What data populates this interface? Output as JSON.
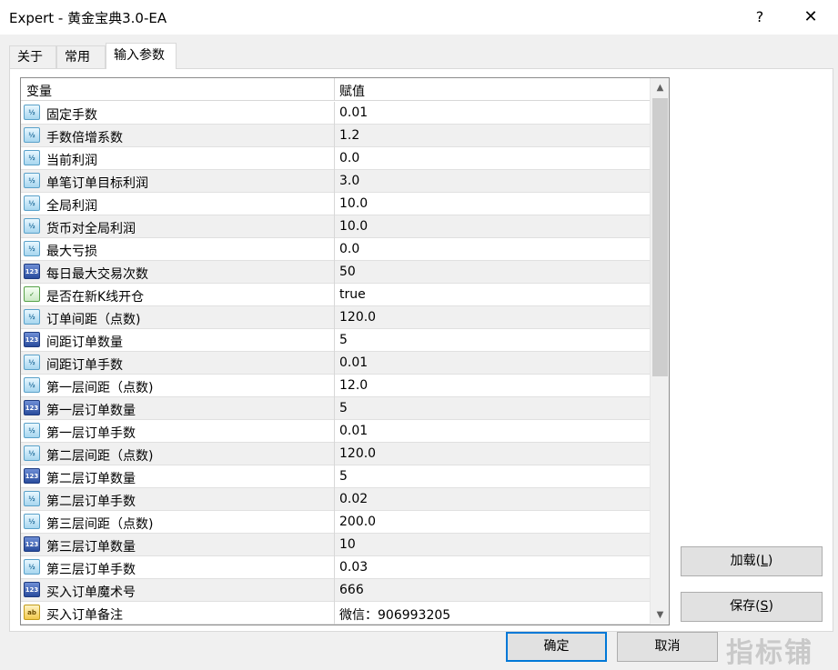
{
  "window": {
    "title": "Expert - 黄金宝典3.0-EA",
    "help_label": "?",
    "close_label": "✕"
  },
  "tabs": [
    {
      "label": "关于"
    },
    {
      "label": "常用"
    },
    {
      "label": "输入参数",
      "active": true
    }
  ],
  "grid": {
    "col_variable": "变量",
    "col_value": "赋值",
    "rows": [
      {
        "type": "double",
        "icon": "½",
        "name": "固定手数",
        "value": "0.01"
      },
      {
        "type": "double",
        "icon": "½",
        "name": "手数倍增系数",
        "value": "1.2"
      },
      {
        "type": "double",
        "icon": "½",
        "name": "当前利润",
        "value": "0.0"
      },
      {
        "type": "double",
        "icon": "½",
        "name": "单笔订单目标利润",
        "value": "3.0"
      },
      {
        "type": "double",
        "icon": "½",
        "name": "全局利润",
        "value": "10.0"
      },
      {
        "type": "double",
        "icon": "½",
        "name": "货币对全局利润",
        "value": "10.0"
      },
      {
        "type": "double",
        "icon": "½",
        "name": "最大亏损",
        "value": "0.0"
      },
      {
        "type": "int",
        "icon": "123",
        "name": "每日最大交易次数",
        "value": "50"
      },
      {
        "type": "bool",
        "icon": "✓",
        "name": "是否在新K线开仓",
        "value": "true"
      },
      {
        "type": "double",
        "icon": "½",
        "name": "订单间距（点数)",
        "value": "120.0"
      },
      {
        "type": "int",
        "icon": "123",
        "name": "间距订单数量",
        "value": "5"
      },
      {
        "type": "double",
        "icon": "½",
        "name": "间距订单手数",
        "value": "0.01"
      },
      {
        "type": "double",
        "icon": "½",
        "name": "第一层间距（点数)",
        "value": "12.0"
      },
      {
        "type": "int",
        "icon": "123",
        "name": "第一层订单数量",
        "value": "5"
      },
      {
        "type": "double",
        "icon": "½",
        "name": "第一层订单手数",
        "value": "0.01"
      },
      {
        "type": "double",
        "icon": "½",
        "name": "第二层间距（点数)",
        "value": "120.0"
      },
      {
        "type": "int",
        "icon": "123",
        "name": "第二层订单数量",
        "value": "5"
      },
      {
        "type": "double",
        "icon": "½",
        "name": "第二层订单手数",
        "value": "0.02"
      },
      {
        "type": "double",
        "icon": "½",
        "name": "第三层间距（点数)",
        "value": "200.0"
      },
      {
        "type": "int",
        "icon": "123",
        "name": "第三层订单数量",
        "value": "10"
      },
      {
        "type": "double",
        "icon": "½",
        "name": "第三层订单手数",
        "value": "0.03"
      },
      {
        "type": "int",
        "icon": "123",
        "name": "买入订单魔术号",
        "value": "666"
      },
      {
        "type": "string",
        "icon": "ab",
        "name": "买入订单备注",
        "value": "微信：906993205"
      }
    ]
  },
  "scrollbar": {
    "up": "▲",
    "down": "▼"
  },
  "buttons": {
    "load": {
      "label": "加载(",
      "key": "L",
      "end": ")"
    },
    "save": {
      "label": "保存(",
      "key": "S",
      "end": ")"
    },
    "ok": "确定",
    "cancel": "取消"
  },
  "watermark": "指标铺"
}
